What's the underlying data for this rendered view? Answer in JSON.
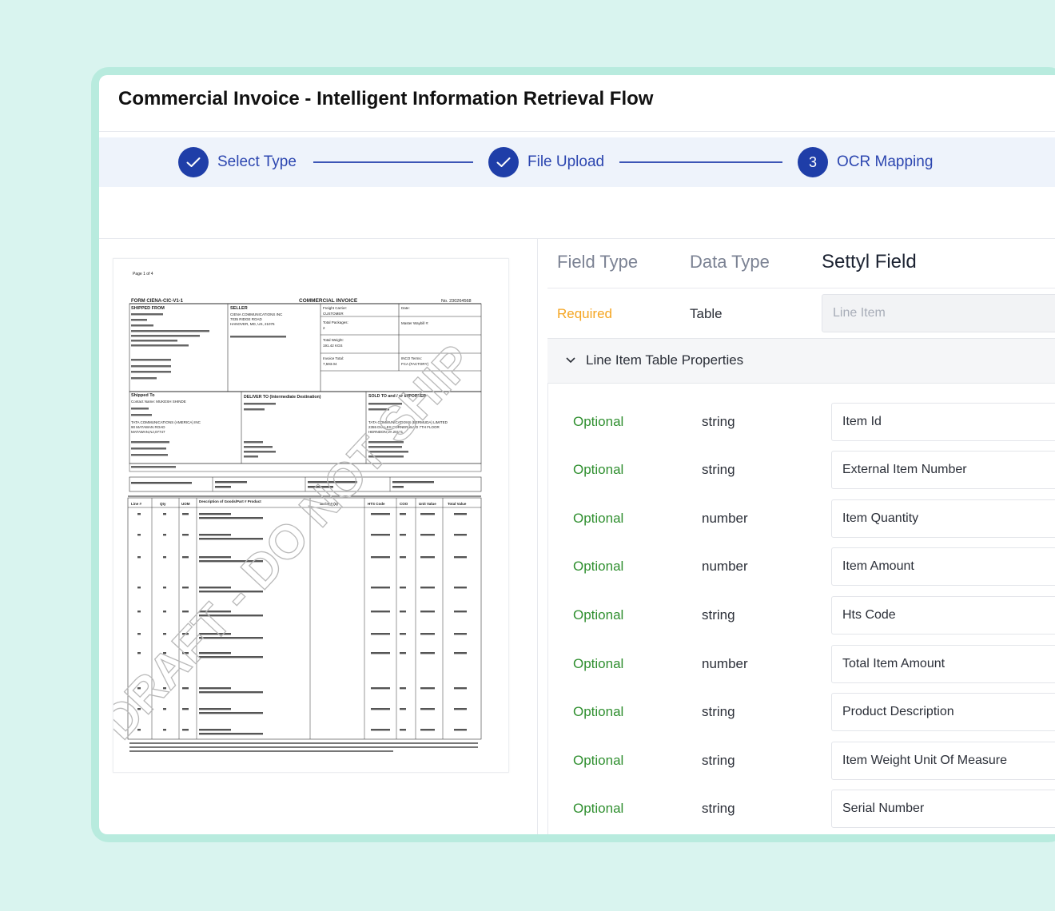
{
  "app": {
    "title": "Commercial Invoice - Intelligent Information Retrieval Flow"
  },
  "stepper": {
    "steps": [
      {
        "label": "Select Type",
        "status": "done"
      },
      {
        "label": "File Upload",
        "status": "done"
      },
      {
        "label": "OCR Mapping",
        "status": "active",
        "number": "3"
      }
    ]
  },
  "document": {
    "page": "Page 1 of 4",
    "form": "FORM CIENA-CIC-V1-1",
    "title": "COMMERCIAL INVOICE",
    "number": "No. 230264568",
    "shipped_from_heading": "SHIPPED FROM",
    "seller_heading": "SELLER",
    "seller_lines": [
      "CIENA COMMUNICATIONS INC",
      "7035 RIDGE ROAD",
      "HANOVER, MD, US, 21076"
    ],
    "freight_label": "Freight Carrier:",
    "freight_value": "CUSTOMER",
    "date_label": "Date:",
    "packages_label": "Total Packages:",
    "packages_value": "2",
    "waybill_label": "Master Waybill #:",
    "weight_label": "Total Weight:",
    "weight_value": "191.42 KGS",
    "invoice_total_label": "Invoice Total:",
    "invoice_total_value": "7,593.04",
    "inco_label": "INCO Terms:",
    "inco_value": "FCA (FACTORY)",
    "shipped_to_heading": "Shipped To",
    "deliver_heading": "DELIVER TO (Intermediate Destination)",
    "sold_heading": "SOLD TO and / or IMPORTER",
    "shipped_to_lines": [
      "Contact Name: MUKESH SHINDE",
      "TATA COMMUNICATIONS (AMERICA) INC",
      "90 MATAWAN ROAD",
      "MATAWAN,NJ,07747"
    ],
    "sold_lines": [
      "TATA COMMUNICATIONS (BERMUDA) LIMITED",
      "2355 DULLES CORNER BLVD 7TH FLOOR",
      "HERNDON,VA 20171"
    ],
    "table_headers": [
      "Line #",
      "Qty",
      "UOM",
      "Description of Goods/Part # Product",
      "Serial # (s)",
      "HTS Code",
      "COO",
      "Unit Value",
      "Total Value"
    ],
    "watermark": "DRAFT - DO NOT SHIP"
  },
  "mapping": {
    "headers": {
      "field_type": "Field Type",
      "data_type": "Data Type",
      "settyl_field": "Settyl Field"
    },
    "required_row": {
      "field_type": "Required",
      "data_type": "Table",
      "settyl_field": "Line Item"
    },
    "accordion_label": "Line Item Table Properties",
    "rows": [
      {
        "field_type": "Optional",
        "data_type": "string",
        "settyl_field": "Item Id"
      },
      {
        "field_type": "Optional",
        "data_type": "string",
        "settyl_field": "External Item Number"
      },
      {
        "field_type": "Optional",
        "data_type": "number",
        "settyl_field": "Item Quantity"
      },
      {
        "field_type": "Optional",
        "data_type": "number",
        "settyl_field": "Item Amount"
      },
      {
        "field_type": "Optional",
        "data_type": "string",
        "settyl_field": "Hts Code"
      },
      {
        "field_type": "Optional",
        "data_type": "number",
        "settyl_field": "Total Item Amount"
      },
      {
        "field_type": "Optional",
        "data_type": "string",
        "settyl_field": "Product Description"
      },
      {
        "field_type": "Optional",
        "data_type": "string",
        "settyl_field": "Item Weight Unit Of Measure"
      },
      {
        "field_type": "Optional",
        "data_type": "string",
        "settyl_field": "Serial Number"
      }
    ]
  },
  "colors": {
    "accent": "#1f3ea8",
    "required": "#f5a623",
    "optional": "#2f8f2f",
    "frame": "#b8ebde",
    "background": "#d9f4ef"
  }
}
